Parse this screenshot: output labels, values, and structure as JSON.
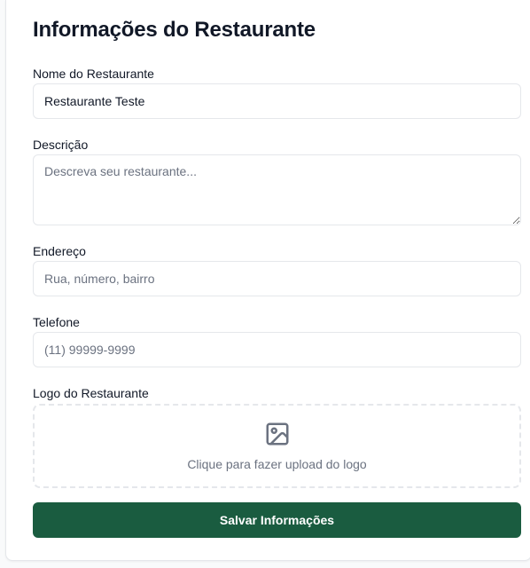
{
  "form": {
    "title": "Informações do Restaurante",
    "name": {
      "label": "Nome do Restaurante",
      "value": "Restaurante Teste",
      "placeholder": ""
    },
    "description": {
      "label": "Descrição",
      "value": "",
      "placeholder": "Descreva seu restaurante..."
    },
    "address": {
      "label": "Endereço",
      "value": "",
      "placeholder": "Rua, número, bairro"
    },
    "phone": {
      "label": "Telefone",
      "value": "",
      "placeholder": "(11) 99999-9999"
    },
    "logo": {
      "label": "Logo do Restaurante",
      "upload_text": "Clique para fazer upload do logo",
      "icon": "image-icon"
    },
    "submit_label": "Salvar Informações"
  },
  "colors": {
    "primary_button": "#1a5c40",
    "border": "#e5e7eb",
    "placeholder_text": "#6b7280",
    "text": "#111827"
  }
}
